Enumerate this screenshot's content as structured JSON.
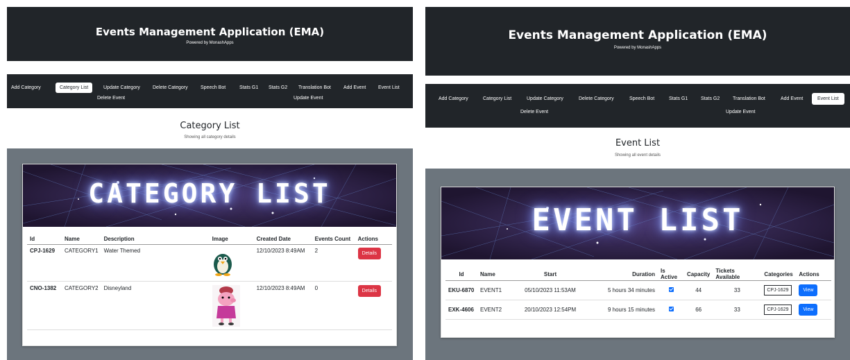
{
  "app": {
    "title": "Events Management Application (EMA)",
    "powered": "Powered by MonashApps"
  },
  "nav": {
    "add_category": "Add Category",
    "category_list": "Category List",
    "update_category": "Update Category",
    "delete_category": "Delete Category",
    "speech_bot": "Speech Bot",
    "stats_g1": "Stats G1",
    "stats_g2": "Stats G2",
    "translation_bot": "Translation Bot",
    "add_event": "Add Event",
    "event_list": "Event List",
    "delete_event": "Delete Event",
    "update_event": "Update Event"
  },
  "category_page": {
    "title": "Category List",
    "subtitle": "Showing all category details",
    "banner": "CATEGORY LIST",
    "headers": [
      "Id",
      "Name",
      "Description",
      "Image",
      "Created Date",
      "Events Count",
      "Actions"
    ],
    "rows": [
      {
        "id": "CPJ-1629",
        "name": "CATEGORY1",
        "description": "Water Themed",
        "created": "12/10/2023 8:49AM",
        "count": "2",
        "action": "Details"
      },
      {
        "id": "CNO-1382",
        "name": "CATEGORY2",
        "description": "Disneyland",
        "created": "12/10/2023 8:49AM",
        "count": "0",
        "action": "Details"
      }
    ]
  },
  "event_page": {
    "title": "Event List",
    "subtitle": "Showing all event details",
    "banner": "EVENT LIST",
    "headers": [
      "Id",
      "Name",
      "Start",
      "Duration",
      "Is Active",
      "Capacity",
      "Tickets Available",
      "Categories",
      "Actions"
    ],
    "rows": [
      {
        "id": "EKU-6870",
        "name": "EVENT1",
        "start": "05/10/2023 11:53AM",
        "duration": "5 hours 34 minutes",
        "capacity": "44",
        "tickets": "33",
        "category": "CPJ-1629",
        "action": "View"
      },
      {
        "id": "EXK-4606",
        "name": "EVENT2",
        "start": "20/10/2023 12:54PM",
        "duration": "9 hours 15 minutes",
        "capacity": "66",
        "tickets": "33",
        "category": "CPJ-1629",
        "action": "View"
      }
    ]
  },
  "colors": {
    "dark": "#212529",
    "gray_panel": "#6c757d",
    "danger": "#dc3545",
    "primary": "#0d6efd"
  }
}
